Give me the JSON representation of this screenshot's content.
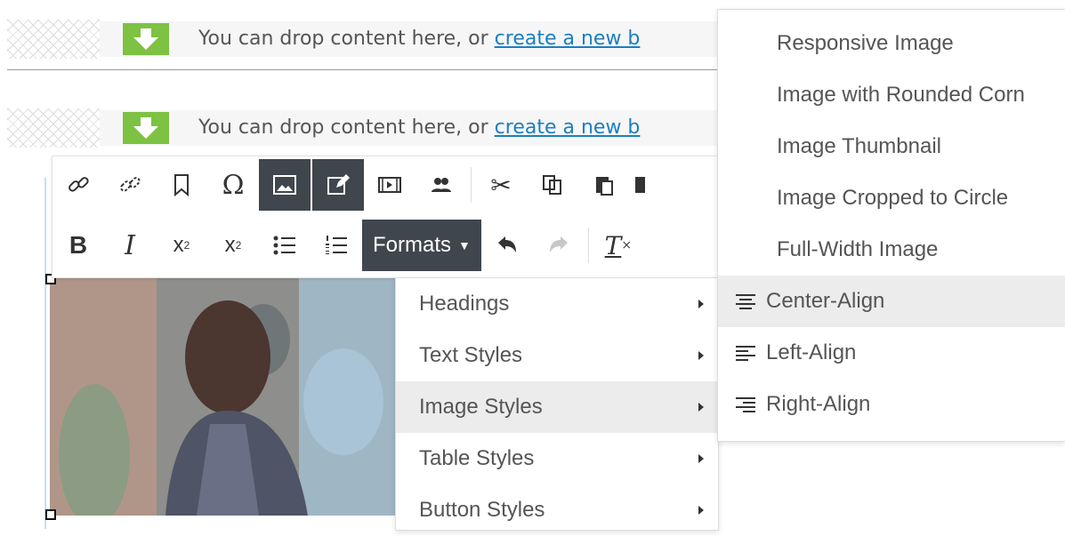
{
  "dropzones": [
    {
      "text": "You can drop content here, or ",
      "link": "create a new b"
    },
    {
      "text": "You can drop content here, or ",
      "link": "create a new b"
    }
  ],
  "toolbar": {
    "formats_label": "Formats"
  },
  "formats_menu": {
    "items": [
      {
        "label": "Headings"
      },
      {
        "label": "Text Styles"
      },
      {
        "label": "Image Styles"
      },
      {
        "label": "Table Styles"
      },
      {
        "label": "Button Styles"
      }
    ],
    "active": "Image Styles"
  },
  "image_styles_menu": {
    "items": [
      {
        "label": "Responsive Image"
      },
      {
        "label": "Image with Rounded Corn"
      },
      {
        "label": "Image Thumbnail"
      },
      {
        "label": "Image Cropped to Circle"
      },
      {
        "label": "Full-Width Image"
      },
      {
        "label": "Center-Align",
        "icon": "align-center-icon"
      },
      {
        "label": "Left-Align",
        "icon": "align-left-icon"
      },
      {
        "label": "Right-Align",
        "icon": "align-right-icon"
      }
    ],
    "active": "Center-Align"
  },
  "colors": {
    "toolbar_active": "#40464d",
    "drop_arrow": "#7dc242",
    "link": "#1a7fc1"
  }
}
